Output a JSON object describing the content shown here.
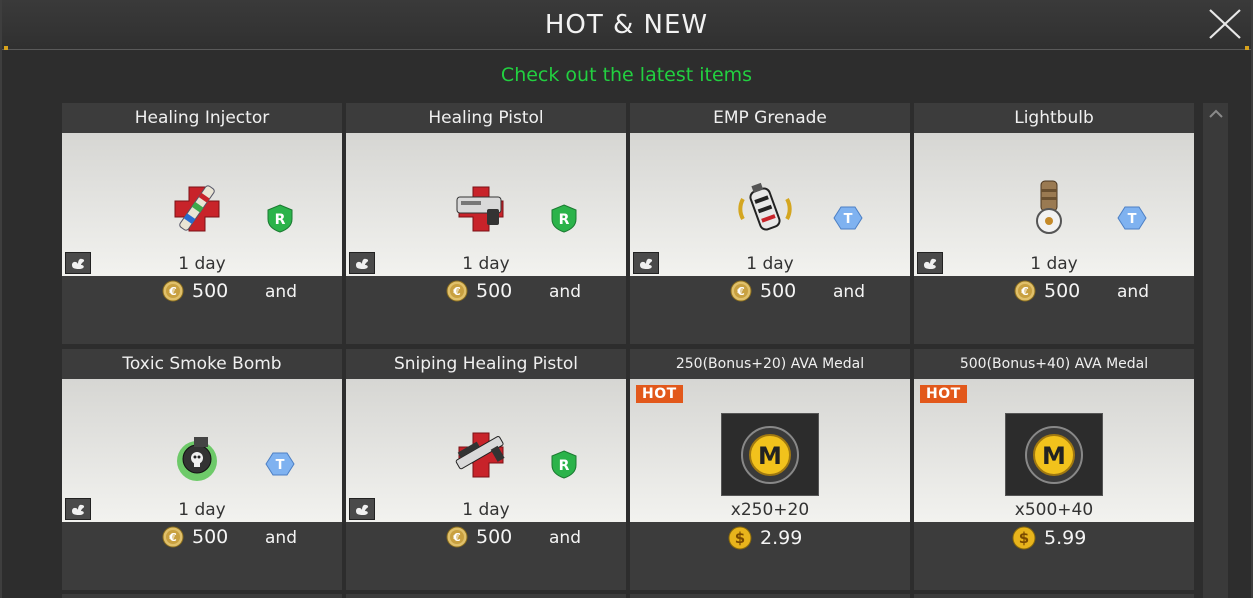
{
  "window": {
    "title": "HOT & NEW",
    "subtitle": "Check out the latest items"
  },
  "items": [
    {
      "name": "Healing Injector",
      "duration": "1 day",
      "price": "500",
      "and": "and",
      "rank": "R",
      "icon": "healing-injector-icon"
    },
    {
      "name": "Healing Pistol",
      "duration": "1 day",
      "price": "500",
      "and": "and",
      "rank": "R",
      "icon": "healing-pistol-icon"
    },
    {
      "name": "EMP Grenade",
      "duration": "1 day",
      "price": "500",
      "and": "and",
      "rank": "T",
      "icon": "emp-grenade-icon"
    },
    {
      "name": "Lightbulb",
      "duration": "1 day",
      "price": "500",
      "and": "and",
      "rank": "T",
      "icon": "lightbulb-grenade-icon"
    },
    {
      "name": "Toxic Smoke Bomb",
      "duration": "1 day",
      "price": "500",
      "and": "and",
      "rank": "T",
      "icon": "toxic-smoke-bomb-icon"
    },
    {
      "name": "Sniping Healing Pistol",
      "duration": "1 day",
      "price": "500",
      "and": "and",
      "rank": "R",
      "icon": "sniping-healing-pistol-icon"
    }
  ],
  "medals": [
    {
      "name": "250(Bonus+20) AVA Medal",
      "tag": "HOT",
      "quantity": "x250+20",
      "price": "2.99",
      "icon": "ava-medal-icon"
    },
    {
      "name": "500(Bonus+40) AVA Medal",
      "tag": "HOT",
      "quantity": "x500+40",
      "price": "5.99",
      "icon": "ava-medal-icon"
    }
  ],
  "colors": {
    "subtitle": "#22d040",
    "hot_tag": "#e2581b",
    "rank_r": "#2bb34a",
    "rank_t": "#7fb2f0",
    "coin": "#d9a620"
  }
}
